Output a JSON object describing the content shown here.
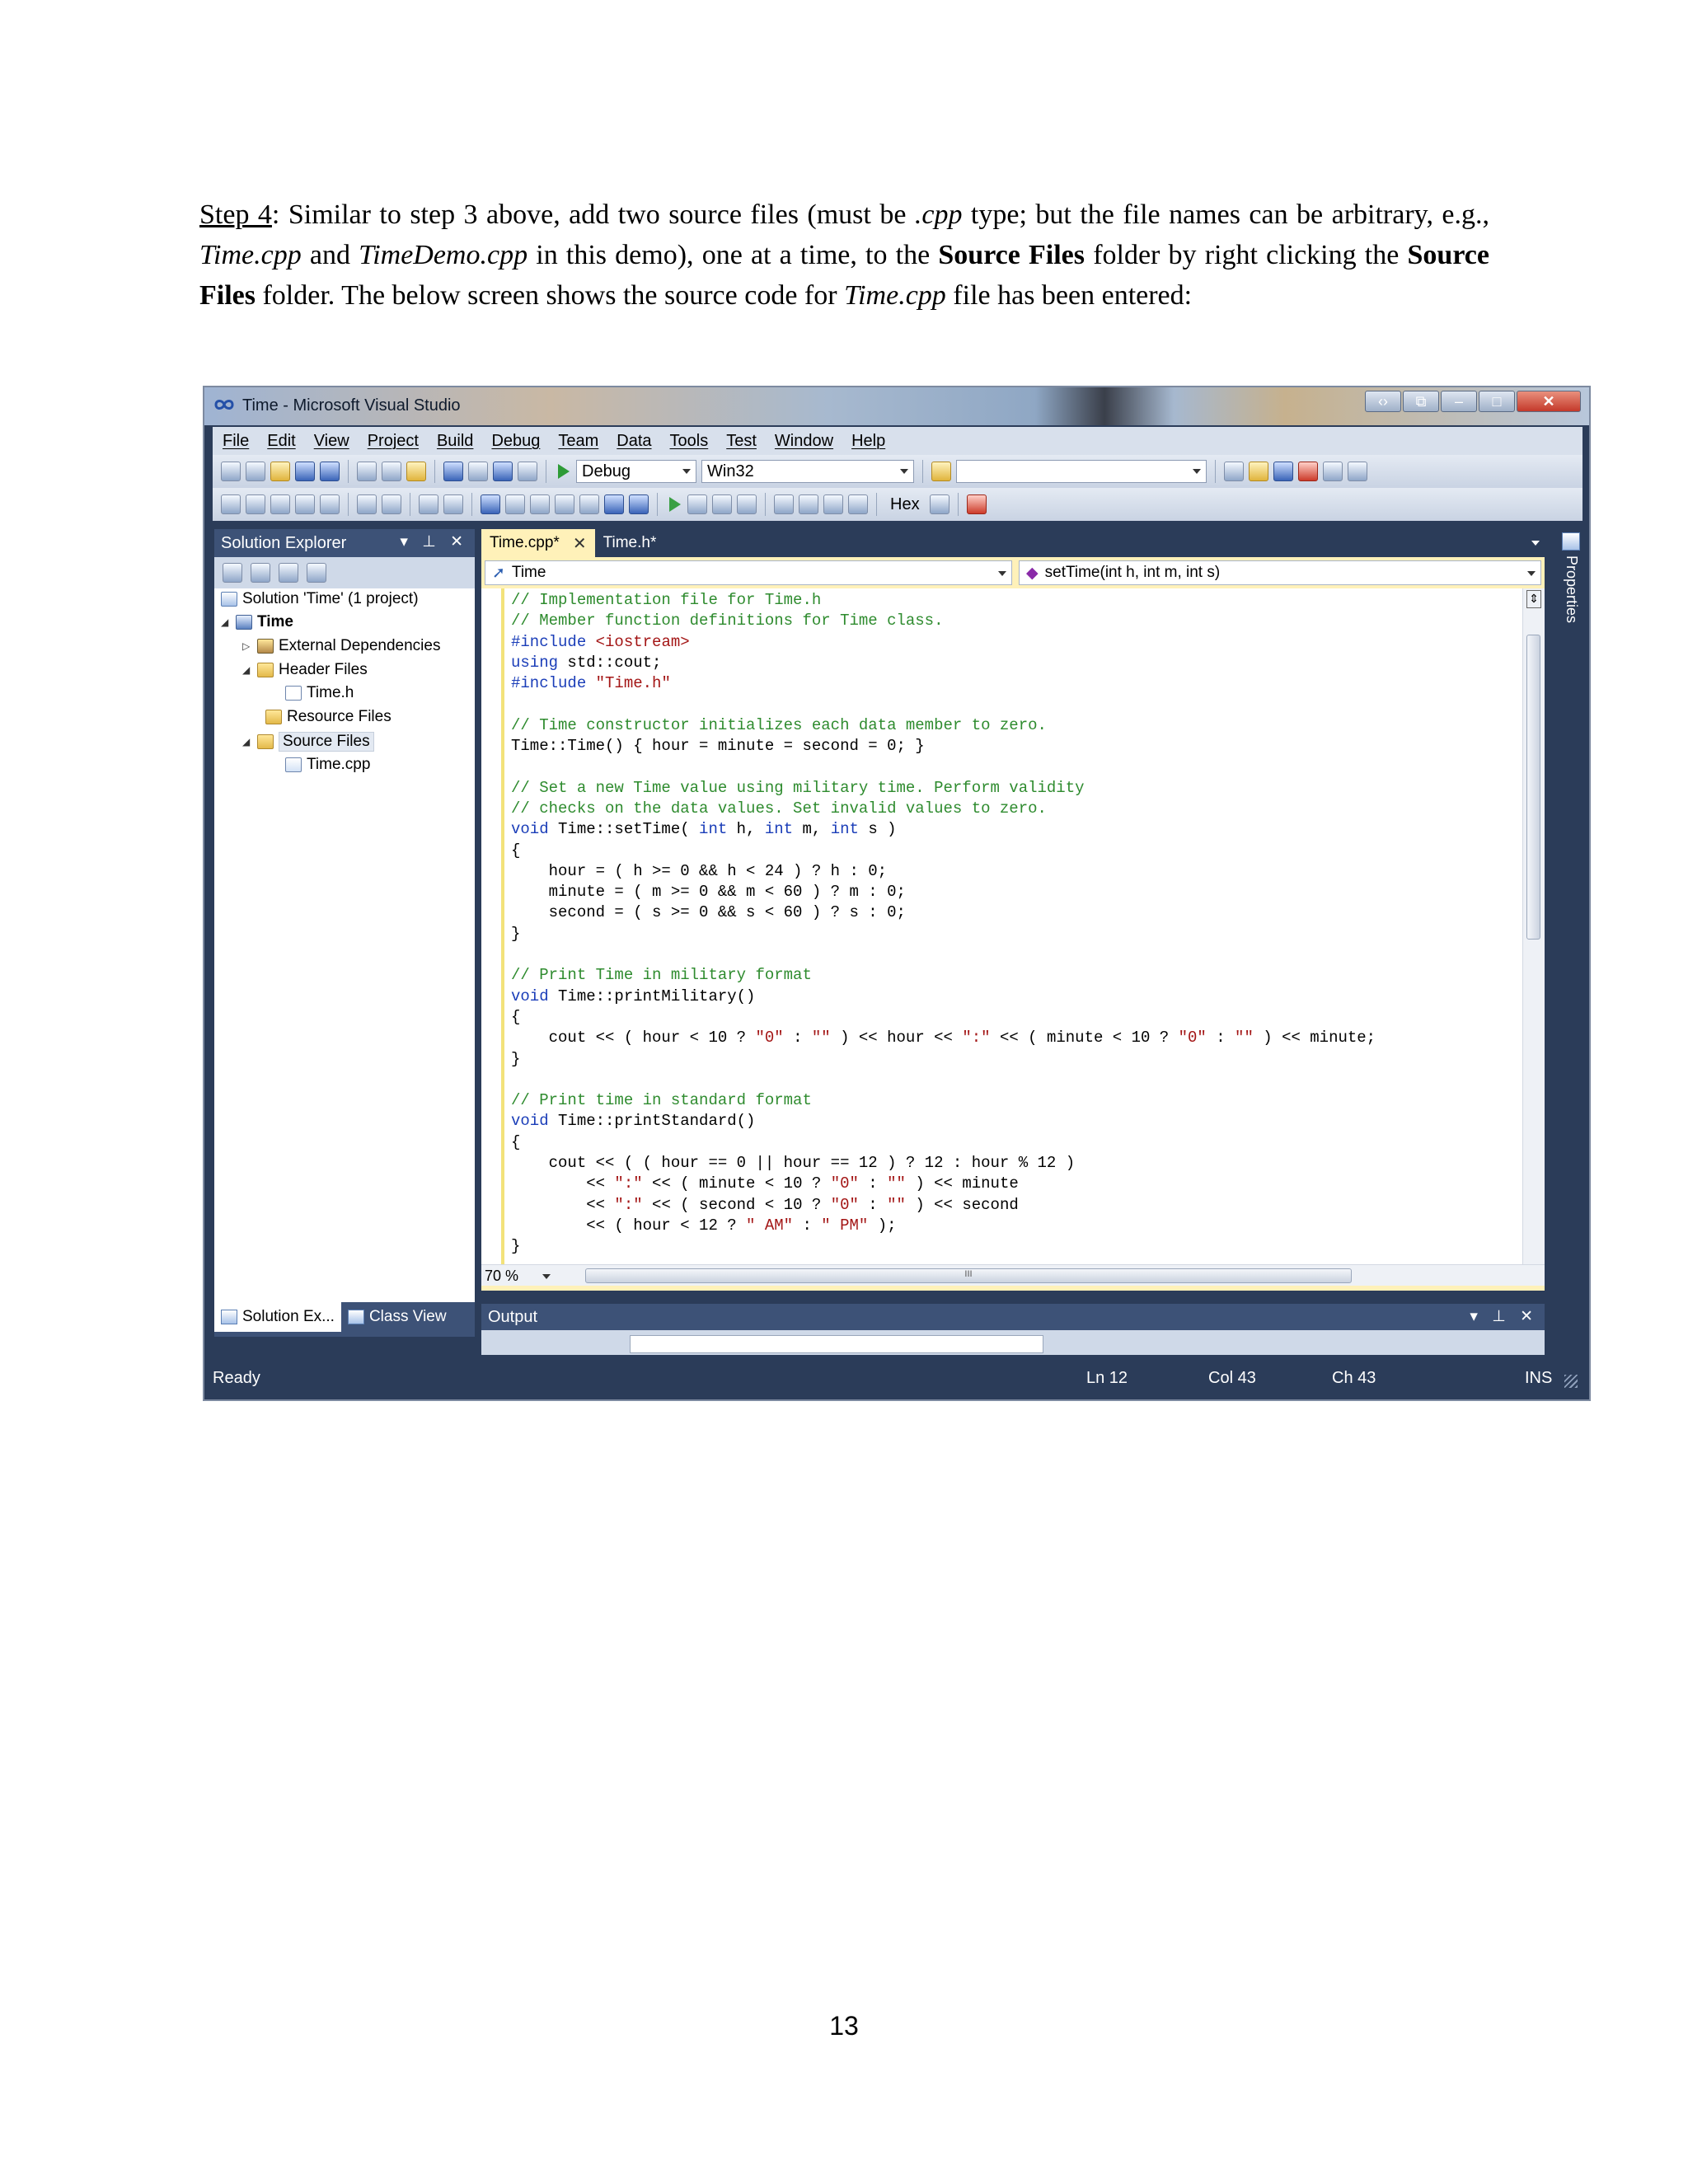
{
  "instructions": {
    "step_label": "Step 4",
    "text_1": ": Similar to step 3 above, add two source files (must be ",
    "ext": ".cpp",
    "text_2": " type; but the file names can be arbitrary, e.g., ",
    "file1": "Time.cpp",
    "text_3": " and ",
    "file2": "TimeDemo.cpp",
    "text_4": " in this demo), one at a time, to the ",
    "folder1": "Source Files",
    "text_5": " folder by right clicking the ",
    "folder2": "Source Files",
    "text_6": " folder. The below screen shows the source code for ",
    "file3": "Time.cpp",
    "text_7": " file has been entered:"
  },
  "window": {
    "title": "Time - Microsoft Visual Studio",
    "menu": [
      "File",
      "Edit",
      "View",
      "Project",
      "Build",
      "Debug",
      "Team",
      "Data",
      "Tools",
      "Test",
      "Window",
      "Help"
    ],
    "toolbar": {
      "config": "Debug",
      "platform": "Win32",
      "search_value": "",
      "hex_label": "Hex"
    }
  },
  "solution_explorer": {
    "title": "Solution Explorer",
    "tree": [
      {
        "label": "Solution 'Time' (1 project)",
        "icon": "solution-icon"
      },
      {
        "label": "Time",
        "icon": "project-icon",
        "bold": true
      },
      {
        "label": "External Dependencies",
        "icon": "dependencies-icon"
      },
      {
        "label": "Header Files",
        "icon": "folder-icon"
      },
      {
        "label": "Time.h",
        "icon": "header-file-icon"
      },
      {
        "label": "Resource Files",
        "icon": "folder-icon"
      },
      {
        "label": "Source Files",
        "icon": "folder-icon",
        "selected": true
      },
      {
        "label": "Time.cpp",
        "icon": "cpp-file-icon"
      }
    ],
    "tabs": [
      "Solution Ex...",
      "Class View"
    ]
  },
  "editor": {
    "tabs": [
      "Time.cpp*",
      "Time.h*"
    ],
    "nav_left": "Time",
    "nav_right": "setTime(int h, int m, int s)",
    "zoom": "70 %",
    "code_lines": [
      [
        {
          "t": "// Implementation file for Time.h",
          "c": "cm"
        }
      ],
      [
        {
          "t": "// Member function definitions for Time class.",
          "c": "cm"
        }
      ],
      [
        {
          "t": "#include ",
          "c": "kw"
        },
        {
          "t": "<iostream>",
          "c": "st"
        }
      ],
      [
        {
          "t": "using",
          "c": "kw"
        },
        {
          "t": " std::cout;",
          "c": ""
        }
      ],
      [
        {
          "t": "#include ",
          "c": "kw"
        },
        {
          "t": "\"Time.h\"",
          "c": "st"
        }
      ],
      [
        {
          "t": "",
          "c": ""
        }
      ],
      [
        {
          "t": "// Time constructor initializes each data member to zero.",
          "c": "cm"
        }
      ],
      [
        {
          "t": "Time::Time() { hour = minute = second = 0; }",
          "c": ""
        }
      ],
      [
        {
          "t": "",
          "c": ""
        }
      ],
      [
        {
          "t": "// Set a new Time value using military time. Perform validity",
          "c": "cm"
        }
      ],
      [
        {
          "t": "// checks on the data values. Set invalid values to zero.",
          "c": "cm"
        }
      ],
      [
        {
          "t": "void",
          "c": "kw"
        },
        {
          "t": " Time::setTime( ",
          "c": ""
        },
        {
          "t": "int",
          "c": "kw"
        },
        {
          "t": " h, ",
          "c": ""
        },
        {
          "t": "int",
          "c": "kw"
        },
        {
          "t": " m, ",
          "c": ""
        },
        {
          "t": "int",
          "c": "kw"
        },
        {
          "t": " s )",
          "c": ""
        }
      ],
      [
        {
          "t": "{",
          "c": ""
        }
      ],
      [
        {
          "t": "    hour = ( h >= 0 && h < 24 ) ? h : 0;",
          "c": ""
        }
      ],
      [
        {
          "t": "    minute = ( m >= 0 && m < 60 ) ? m : 0;",
          "c": ""
        }
      ],
      [
        {
          "t": "    second = ( s >= 0 && s < 60 ) ? s : 0;",
          "c": ""
        }
      ],
      [
        {
          "t": "}",
          "c": ""
        }
      ],
      [
        {
          "t": "",
          "c": ""
        }
      ],
      [
        {
          "t": "// Print Time in military format",
          "c": "cm"
        }
      ],
      [
        {
          "t": "void",
          "c": "kw"
        },
        {
          "t": " Time::printMilitary()",
          "c": ""
        }
      ],
      [
        {
          "t": "{",
          "c": ""
        }
      ],
      [
        {
          "t": "    cout << ( hour < 10 ? ",
          "c": ""
        },
        {
          "t": "\"0\"",
          "c": "st"
        },
        {
          "t": " : ",
          "c": ""
        },
        {
          "t": "\"\"",
          "c": "st"
        },
        {
          "t": " ) << hour << ",
          "c": ""
        },
        {
          "t": "\":\"",
          "c": "st"
        },
        {
          "t": " << ( minute < 10 ? ",
          "c": ""
        },
        {
          "t": "\"0\"",
          "c": "st"
        },
        {
          "t": " : ",
          "c": ""
        },
        {
          "t": "\"\"",
          "c": "st"
        },
        {
          "t": " ) << minute;",
          "c": ""
        }
      ],
      [
        {
          "t": "}",
          "c": ""
        }
      ],
      [
        {
          "t": "",
          "c": ""
        }
      ],
      [
        {
          "t": "// Print time in standard format",
          "c": "cm"
        }
      ],
      [
        {
          "t": "void",
          "c": "kw"
        },
        {
          "t": " Time::printStandard()",
          "c": ""
        }
      ],
      [
        {
          "t": "{",
          "c": ""
        }
      ],
      [
        {
          "t": "    cout << ( ( hour == 0 || hour == 12 ) ? 12 : hour % 12 )",
          "c": ""
        }
      ],
      [
        {
          "t": "        << ",
          "c": ""
        },
        {
          "t": "\":\"",
          "c": "st"
        },
        {
          "t": " << ( minute < 10 ? ",
          "c": ""
        },
        {
          "t": "\"0\"",
          "c": "st"
        },
        {
          "t": " : ",
          "c": ""
        },
        {
          "t": "\"\"",
          "c": "st"
        },
        {
          "t": " ) << minute",
          "c": ""
        }
      ],
      [
        {
          "t": "        << ",
          "c": ""
        },
        {
          "t": "\":\"",
          "c": "st"
        },
        {
          "t": " << ( second < 10 ? ",
          "c": ""
        },
        {
          "t": "\"0\"",
          "c": "st"
        },
        {
          "t": " : ",
          "c": ""
        },
        {
          "t": "\"\"",
          "c": "st"
        },
        {
          "t": " ) << second",
          "c": ""
        }
      ],
      [
        {
          "t": "        << ( hour < 12 ? ",
          "c": ""
        },
        {
          "t": "\" AM\"",
          "c": "st"
        },
        {
          "t": " : ",
          "c": ""
        },
        {
          "t": "\" PM\"",
          "c": "st"
        },
        {
          "t": " );",
          "c": ""
        }
      ],
      [
        {
          "t": "}",
          "c": ""
        }
      ]
    ]
  },
  "output": {
    "title": "Output"
  },
  "properties_label": "Properties",
  "status": {
    "ready": "Ready",
    "ln": "Ln 12",
    "col": "Col 43",
    "ch": "Ch 43",
    "mode": "INS"
  },
  "page_number": "13"
}
